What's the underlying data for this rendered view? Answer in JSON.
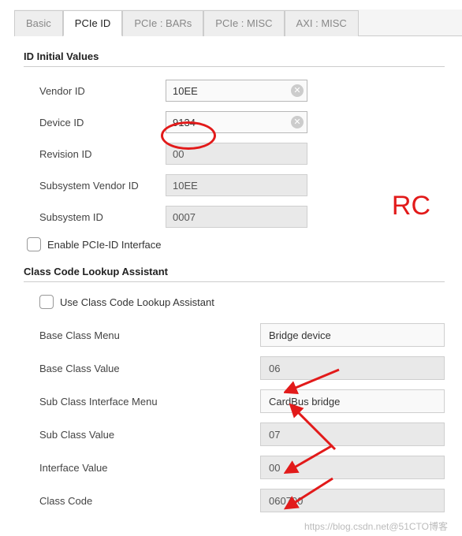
{
  "tabs": {
    "basic": "Basic",
    "pcieid": "PCIe ID",
    "bars": "PCIe : BARs",
    "misc": "PCIe : MISC",
    "axi": "AXI : MISC"
  },
  "sections": {
    "id_initial": "ID Initial Values",
    "class_lookup": "Class Code Lookup Assistant"
  },
  "labels": {
    "vendor_id": "Vendor ID",
    "device_id": "Device ID",
    "revision_id": "Revision ID",
    "subsys_vendor_id": "Subsystem Vendor ID",
    "subsys_id": "Subsystem ID",
    "enable_pcieid": "Enable PCIe-ID Interface",
    "use_class_lookup": "Use Class Code Lookup Assistant",
    "base_class_menu": "Base Class Menu",
    "base_class_value": "Base Class Value",
    "sub_class_menu": "Sub Class Interface Menu",
    "sub_class_value": "Sub Class Value",
    "interface_value": "Interface Value",
    "class_code": "Class Code"
  },
  "values": {
    "vendor_id": "10EE",
    "device_id": "9134",
    "revision_id": "00",
    "subsys_vendor_id": "10EE",
    "subsys_id": "0007",
    "base_class_menu": "Bridge device",
    "base_class_value": "06",
    "sub_class_menu": "CardBus bridge",
    "sub_class_value": "07",
    "interface_value": "00",
    "class_code": "060700"
  },
  "annotations": {
    "rc": "RC",
    "watermark": "https://blog.csdn.net@51CTO博客"
  }
}
